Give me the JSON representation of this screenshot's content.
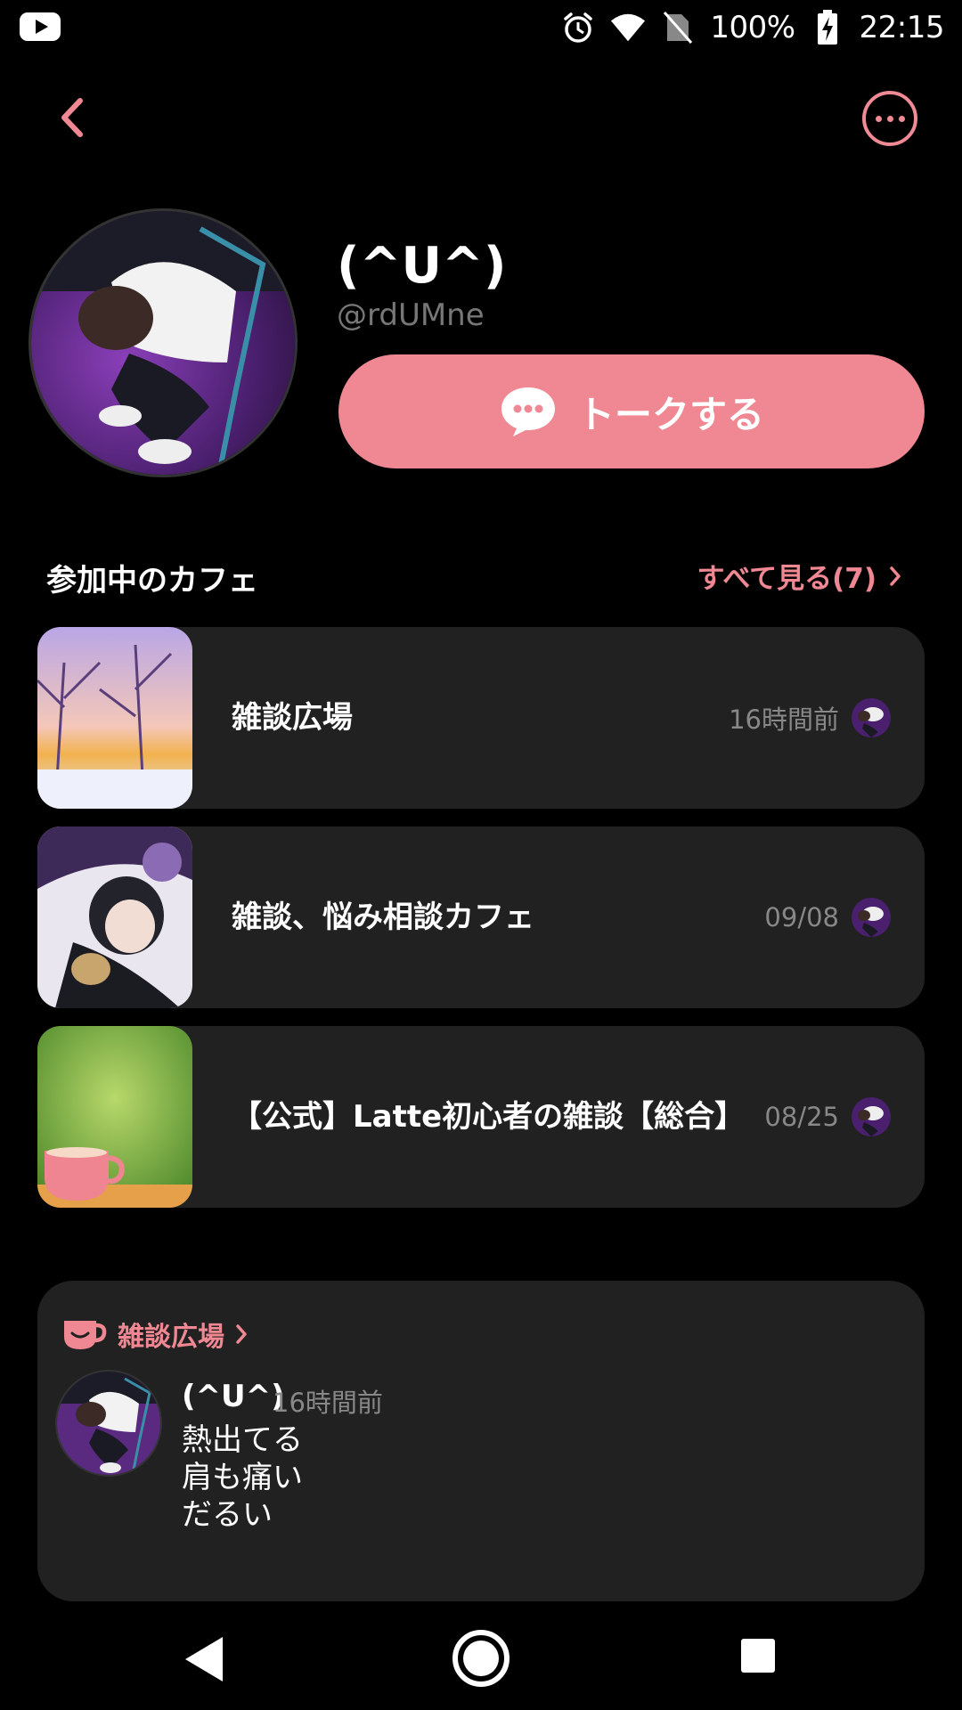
{
  "status_bar": {
    "battery": "100%",
    "time": "22:15"
  },
  "profile": {
    "name": "(^U^)",
    "handle": "@rdUMne",
    "talk_label": "トークする"
  },
  "cafes_section": {
    "title": "参加中のカフェ",
    "see_all": "すべて見る(7)"
  },
  "cafes": [
    {
      "name": "雑談広場",
      "time": "16時間前"
    },
    {
      "name": "雑談、悩み相談カフェ",
      "time": "09/08"
    },
    {
      "name": "【公式】Latte初心者の雑談【総合】",
      "time": "08/25"
    }
  ],
  "post": {
    "cafe_name": "雑談広場",
    "author": "(^U^)",
    "time": "16時間前",
    "lines": [
      "熱出てる",
      "肩も痛い",
      "だるい"
    ]
  },
  "colors": {
    "accent": "#ef8892",
    "card": "#212121",
    "background": "#000000"
  }
}
